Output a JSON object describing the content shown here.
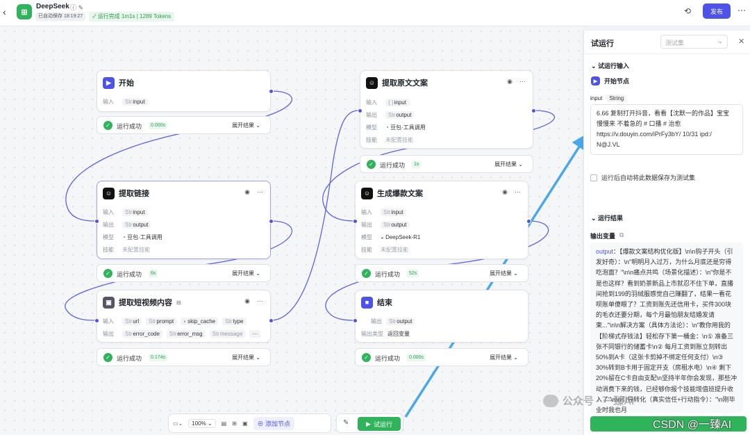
{
  "topbar": {
    "back_icon": "chevron-left-icon",
    "app_title": "DeepSeek",
    "autosave": "已自动保存 18:19:27",
    "run_status": "运行完成 1m1s | 1289 Tokens",
    "publish_label": "发布"
  },
  "nodes": {
    "start": {
      "title": "开始",
      "input_label": "输入",
      "input_var": "input",
      "result": {
        "status": "运行成功",
        "time": "0.000s",
        "expand": "展开结果"
      }
    },
    "extract_link": {
      "title": "提取链接",
      "input_label": "输入",
      "input_var": "input",
      "output_label": "输出",
      "output_var": "output",
      "model_label": "模型",
      "model": "豆包·工具调用",
      "skill_label": "技能",
      "skill": "未配置技能",
      "result": {
        "status": "运行成功",
        "time": "6s",
        "expand": "展开结果"
      }
    },
    "extract_video": {
      "title": "提取短视频内容",
      "input_label": "输入",
      "inputs": [
        "url",
        "prompt",
        "skip_cache",
        "type"
      ],
      "output_label": "输出",
      "outputs": [
        "error_code",
        "error_msg",
        "message"
      ],
      "more": "···",
      "result": {
        "status": "运行成功",
        "time": "0.174s",
        "expand": "展开结果"
      }
    },
    "extract_copy": {
      "title": "提取原文文案",
      "input_label": "输入",
      "input_var": "input",
      "output_label": "输出",
      "output_var": "output",
      "model_label": "模型",
      "model": "豆包·工具调用",
      "skill_label": "技能",
      "skill": "未配置技能",
      "result": {
        "status": "运行成功",
        "time": "1s",
        "expand": "展开结果"
      }
    },
    "generate": {
      "title": "生成爆款文案",
      "input_label": "输入",
      "input_var": "input",
      "output_label": "输出",
      "output_var": "output",
      "model_label": "模型",
      "model": "DeepSeek-R1",
      "skill_label": "技能",
      "skill": "未配置技能",
      "result": {
        "status": "运行成功",
        "time": "52s",
        "expand": "展开结果"
      }
    },
    "end": {
      "title": "结束",
      "output_label": "输出",
      "output_var": "output",
      "type_label": "输出类型",
      "type_value": "返回变量",
      "result": {
        "status": "运行成功",
        "time": "0.000s",
        "expand": "展开结果"
      }
    }
  },
  "bottom": {
    "zoom": "100%",
    "add_node": "添加节点",
    "run": "试运行"
  },
  "panel": {
    "title": "试运行",
    "testset_placeholder": "测试集",
    "input_section": "试运行输入",
    "start_node": "开始节点",
    "input_name": "input",
    "input_type": "String",
    "input_value": "6.66 复制打开抖音，看看【沈默一的作品】宝宝 慢慢来 不着急的 # 口播 # 治愈 https://v.douyin.com/iPrFy3bY/ 10/31 ipd:/ N@J.VL",
    "save_testset": "运行后自动将此数据保存为测试集",
    "result_section": "运行结果",
    "output_var_label": "输出变量",
    "output_key": "output",
    "output_text": "：【爆款文案结构优化版】\\n\\n钩子开头（引发好奇）：\\n\"明明月入过万，为什么月底还是穷得吃泡面？\"\\n\\n痛点共鸣（场景化描述）：\\n\"你是不是也这样？看到奶茶新品上市就忍不住下单，直播间抢到199的羽绒服感觉自己赚翻了，结果一看花呗账单傻眼了？工资到账先还信用卡，买件300块的毛衣还要分期，每个月最怕朋友结婚发请柬...\"\\n\\n解决方案（具体方法论）：\\n\"教你用我的【阶梯式存钱法】轻松存下第一桶金：\\n① 准备三张不同银行的储蓄卡\\n② 每月工资到账立刻转出50%到A卡（这张卡剪掉不绑定任何支付）\\n③ 30%转到B卡用于固定开支（房租水电）\\n④ 剩下20%留在C卡自由支配\\n坚持半年你会发现，那些冲动消费下来的钱，已经够你报个技能增值班提升收入了\"\\n\\n引导转化（真实信任+行动指令）：\"\\n刚毕业时我也月"
  },
  "watermark": {
    "channel": "公众号 · 一臻AI",
    "csdn": "CSDN @一臻AI"
  }
}
